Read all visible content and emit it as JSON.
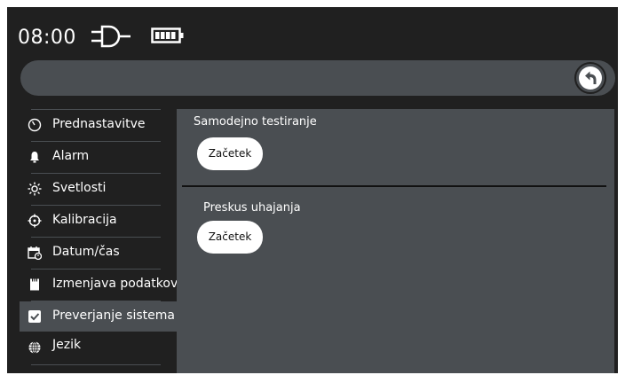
{
  "status": {
    "time": "08:00",
    "power_icon": "plug-icon",
    "battery_icon": "battery-icon"
  },
  "nav": {
    "back_icon": "back-arrow-icon"
  },
  "sidebar": {
    "items": [
      {
        "label": "Prednastavitve",
        "icon": "clock-circle-icon"
      },
      {
        "label": "Alarm",
        "icon": "bell-icon"
      },
      {
        "label": "Svetlosti",
        "icon": "sun-icon"
      },
      {
        "label": "Kalibracija",
        "icon": "crosshair-icon"
      },
      {
        "label": "Datum/čas",
        "icon": "calendar-icon"
      },
      {
        "label": "Izmenjava podatkov",
        "icon": "sd-card-icon"
      },
      {
        "label": "Preverjanje sistema",
        "icon": "checkbox-icon",
        "active": true
      },
      {
        "label": "Jezik",
        "icon": "globe-icon"
      }
    ]
  },
  "main": {
    "self_test": {
      "title": "Samodejno testiranje",
      "button": "Začetek"
    },
    "leak_test": {
      "title": "Preskus uhajanja",
      "button": "Začetek"
    }
  },
  "colors": {
    "background": "#202020",
    "panel": "#4a4e52",
    "text": "#ffffff",
    "button": "#ffffff"
  }
}
